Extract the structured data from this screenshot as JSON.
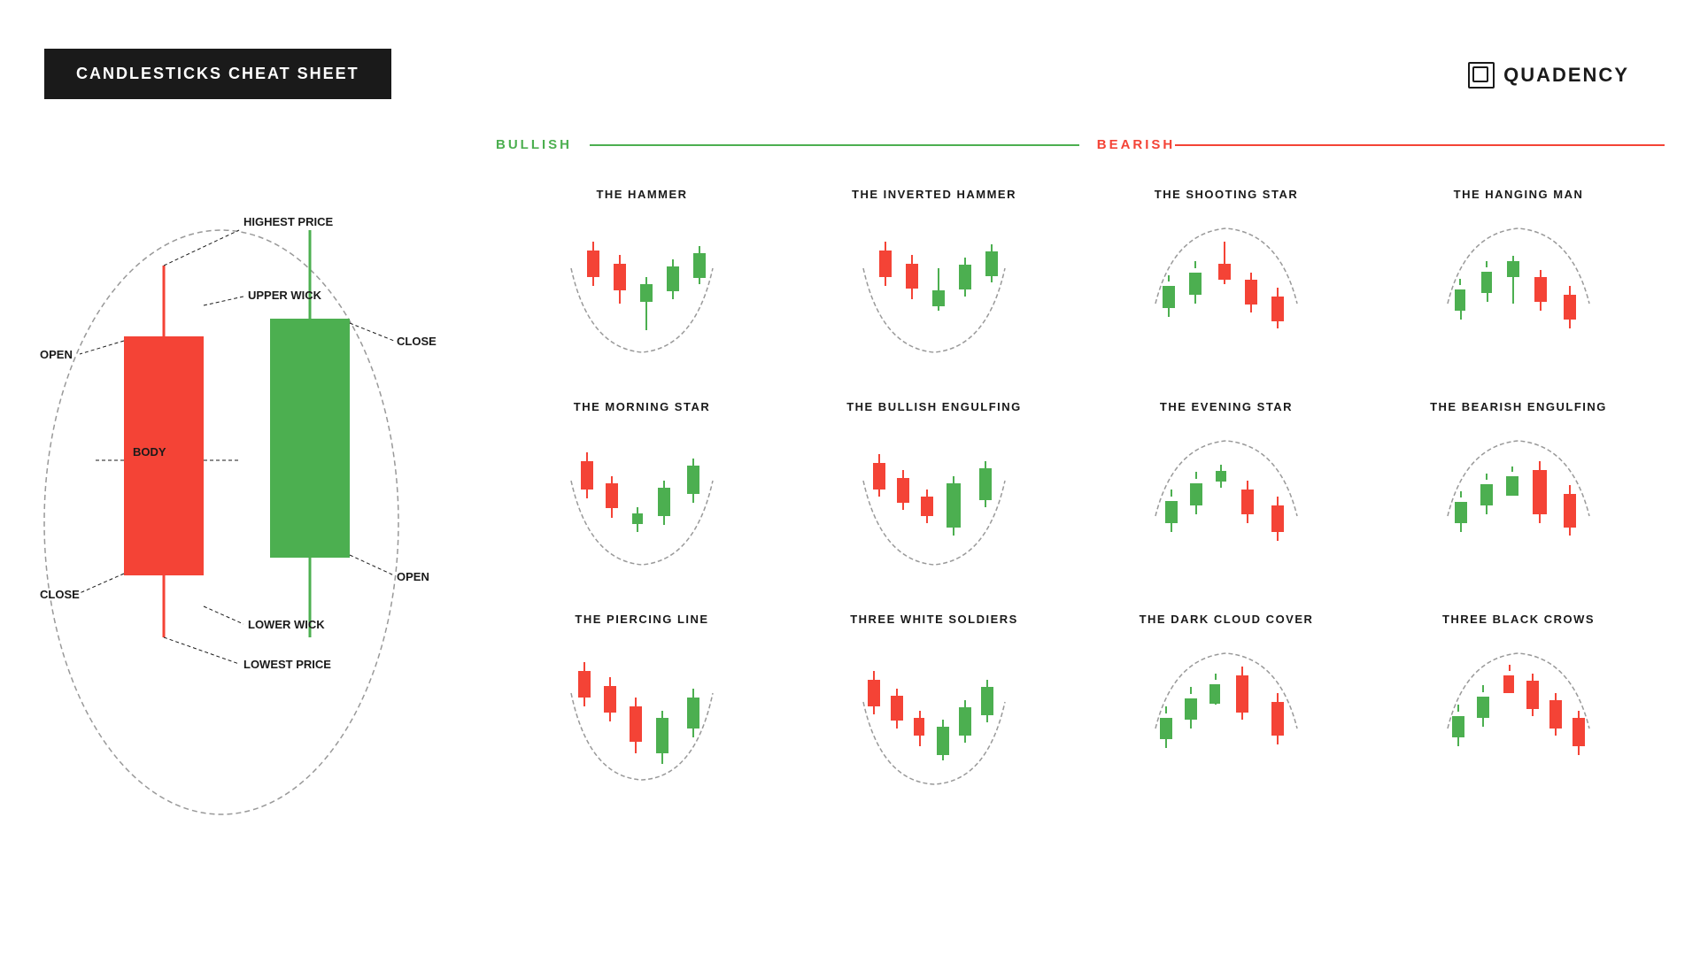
{
  "header": {
    "title": "CANDLESTICKS CHEAT SHEET",
    "logo_text": "QUADENCY"
  },
  "diagram": {
    "labels": {
      "highest_price": "HIGHEST PRICE",
      "upper_wick": "UPPER WICK",
      "open_red": "OPEN",
      "close_red": "CLOSE",
      "body": "BODY",
      "close_green": "CLOSE",
      "open_green": "OPEN",
      "lower_wick": "LOWER WICK",
      "lowest_price": "LOWEST PRICE"
    }
  },
  "sections": {
    "bullish": "BULLISH",
    "bearish": "BEARISH"
  },
  "patterns": [
    {
      "id": "hammer",
      "title": "THE HAMMER",
      "type": "bullish"
    },
    {
      "id": "inverted_hammer",
      "title": "THE INVERTED HAMMER",
      "type": "bullish"
    },
    {
      "id": "shooting_star",
      "title": "THE SHOOTING STAR",
      "type": "bearish"
    },
    {
      "id": "hanging_man",
      "title": "THE HANGING MAN",
      "type": "bearish"
    },
    {
      "id": "morning_star",
      "title": "THE MORNING STAR",
      "type": "bullish"
    },
    {
      "id": "bullish_engulfing",
      "title": "THE BULLISH ENGULFING",
      "type": "bullish"
    },
    {
      "id": "evening_star",
      "title": "THE EVENING STAR",
      "type": "bearish"
    },
    {
      "id": "bearish_engulfing",
      "title": "THE BEARISH ENGULFING",
      "type": "bearish"
    },
    {
      "id": "piercing_line",
      "title": "THE PIERCING LINE",
      "type": "bullish"
    },
    {
      "id": "three_white_soldiers",
      "title": "THREE WHITE SOLDIERS",
      "type": "bullish"
    },
    {
      "id": "dark_cloud_cover",
      "title": "THE DARK CLOUD COVER",
      "type": "bearish"
    },
    {
      "id": "three_black_crows",
      "title": "THREE BLACK CROWS",
      "type": "bearish"
    }
  ],
  "colors": {
    "bullish": "#4caf50",
    "bearish": "#f44336",
    "background": "#ffffff",
    "text": "#1a1a1a"
  }
}
